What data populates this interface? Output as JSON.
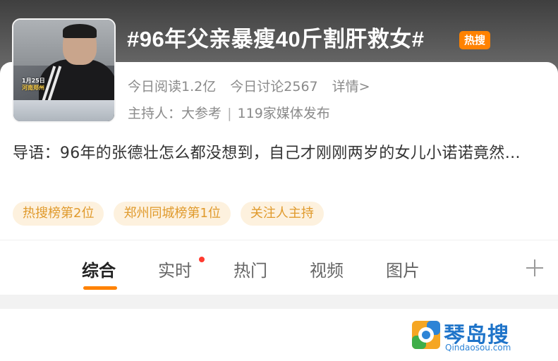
{
  "topic": {
    "title": "#96年父亲暴瘦40斤割肝救女#",
    "badge": "热搜",
    "thumbnail_caption_date": "1月25日",
    "thumbnail_caption_location": "河南郑州"
  },
  "stats": {
    "reads": "今日阅读1.2亿",
    "discussions": "今日讨论2567",
    "details_link": "详情>"
  },
  "host": {
    "label": "主持人：",
    "name": "大参考",
    "separator": "|",
    "media": "119家媒体发布"
  },
  "intro": {
    "text": "导语：96年的张德壮怎么都没想到，自己才刚刚两岁的女儿小诺诺竟然…"
  },
  "tags": [
    "热搜榜第2位",
    "郑州同城榜第1位",
    "关注人主持"
  ],
  "tabs": [
    {
      "label": "综合",
      "active": true
    },
    {
      "label": "实时",
      "active": false,
      "has_dot": true
    },
    {
      "label": "热门",
      "active": false
    },
    {
      "label": "视频",
      "active": false
    },
    {
      "label": "图片",
      "active": false
    }
  ],
  "watermark": {
    "name": "琴岛搜",
    "url": "Qindaosou.com"
  },
  "colors": {
    "accent": "#ff8200",
    "tag_bg": "#fdf1de",
    "tag_text": "#e09a2c",
    "notification_dot": "#ff3b30"
  },
  "icons": [
    "plus-icon",
    "watermark-logo-icon"
  ]
}
